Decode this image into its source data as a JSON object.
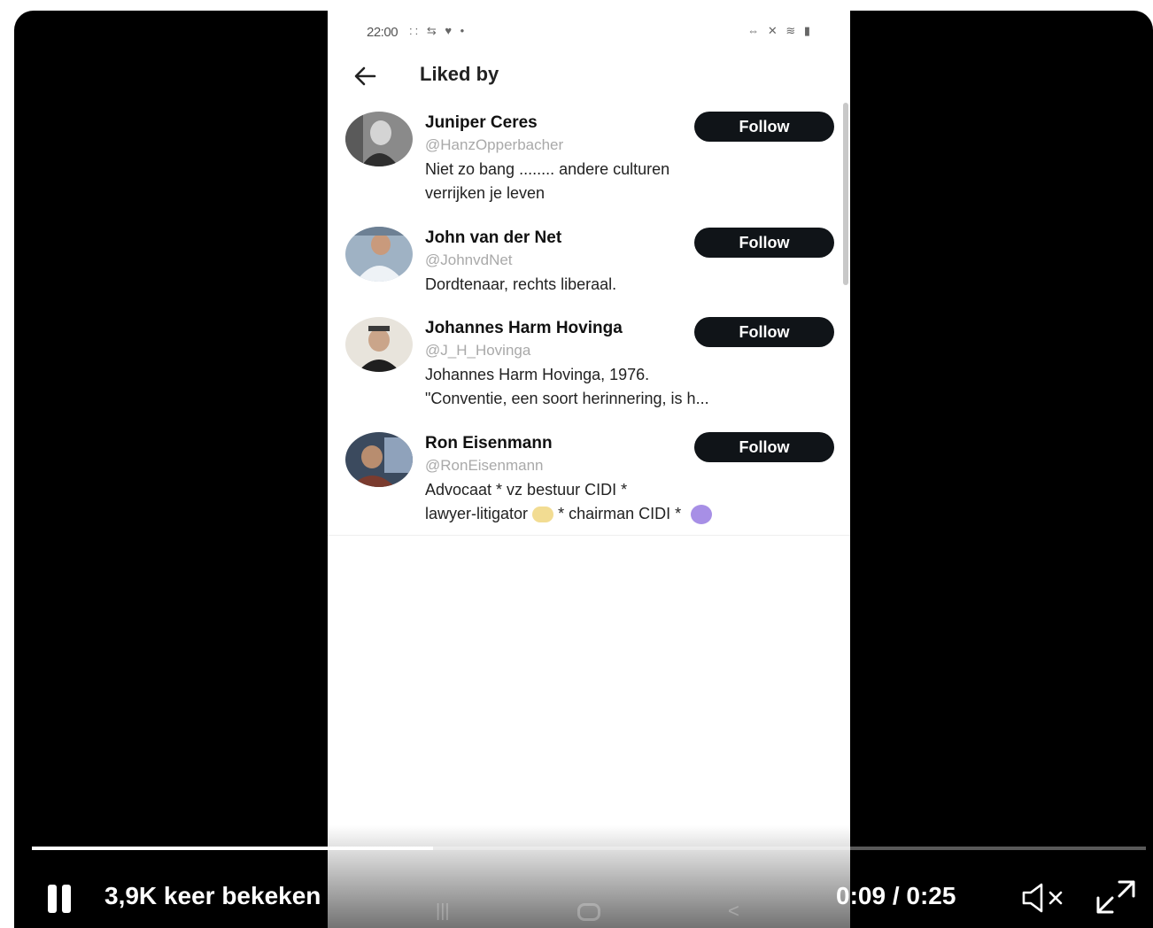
{
  "status_bar": {
    "time": "22:00",
    "left_icons": ":: ⇆ ♥ •",
    "right_icons": "⇔ ✕ ≋ ▮"
  },
  "header": {
    "back_icon": "arrow-left-icon",
    "title": "Liked by"
  },
  "users": [
    {
      "name": "Juniper Ceres",
      "handle": "@HanzOpperbacher",
      "bio_lines": [
        "Niet zo bang ........ andere culturen",
        "verrijken je leven"
      ],
      "follow_label": "Follow"
    },
    {
      "name": "John van der Net",
      "handle": "@JohnvdNet",
      "bio_lines": [
        "Dordtenaar, rechts liberaal."
      ],
      "follow_label": "Follow"
    },
    {
      "name": "Johannes Harm Hovinga",
      "handle": "@J_H_Hovinga",
      "bio_lines": [
        "Johannes Harm Hovinga, 1976.",
        "\"Conventie, een soort herinnering, is h..."
      ],
      "follow_label": "Follow"
    },
    {
      "name": "Ron Eisenmann",
      "handle": "@RonEisenmann",
      "bio_lines": [
        "Advocaat * vz bestuur CIDI *",
        "lawyer-litigator",
        "* chairman CIDI *"
      ],
      "follow_label": "Follow"
    }
  ],
  "player": {
    "views": "3,9K keer bekeken",
    "current_time": "0:09",
    "duration": "0:25",
    "time_separator": " / ",
    "progress_fraction": 0.36,
    "pause_icon": "pause-icon",
    "mute_icon": "speaker-muted-icon",
    "fullscreen_icon": "fullscreen-icon"
  },
  "colors": {
    "follow_button": "#101418",
    "player_background": "#000000",
    "handle_text": "#a9a9a9"
  }
}
